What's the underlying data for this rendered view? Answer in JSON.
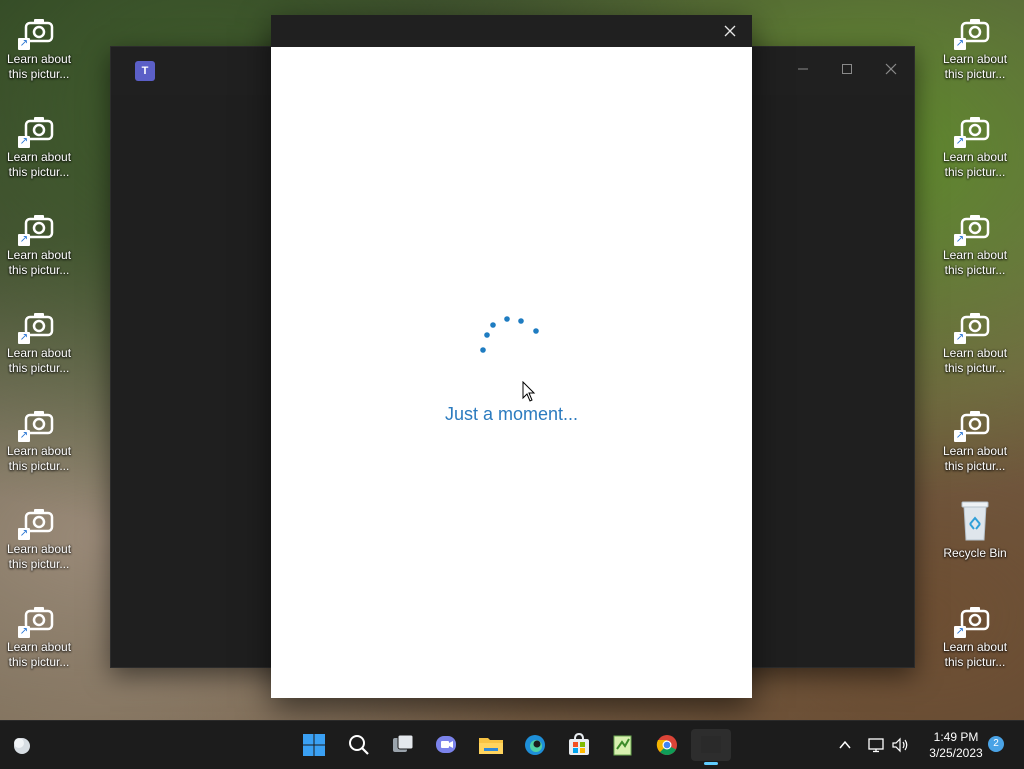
{
  "desktop": {
    "left_column": [
      {
        "label": "Learn about\nthis pictur..."
      },
      {
        "label": "Learn about\nthis pictur..."
      },
      {
        "label": "Learn about\nthis pictur..."
      },
      {
        "label": "Learn about\nthis pictur..."
      },
      {
        "label": "Learn about\nthis pictur..."
      },
      {
        "label": "Learn about\nthis pictur..."
      },
      {
        "label": "Learn about\nthis pictur..."
      }
    ],
    "right_column": [
      {
        "label": "Learn about\nthis pictur..."
      },
      {
        "label": "Learn about\nthis pictur..."
      },
      {
        "label": "Learn about\nthis pictur..."
      },
      {
        "label": "Learn about\nthis pictur..."
      },
      {
        "label": "Learn about\nthis pictur..."
      },
      {
        "label": "Recycle Bin"
      },
      {
        "label": "Learn about\nthis pictur..."
      }
    ]
  },
  "teams_window": {
    "logo_letter": "T"
  },
  "dialog": {
    "loading_text": "Just a moment..."
  },
  "taskbar": {
    "apps": [
      "widgets-icon",
      "start-icon",
      "search-icon",
      "task-view-icon",
      "teams-chat-icon",
      "file-explorer-icon",
      "edge-icon",
      "store-icon",
      "notepad-plus-icon",
      "chrome-icon",
      "active-window-icon"
    ],
    "time": "1:49 PM",
    "date": "3/25/2023",
    "notification_count": "2"
  },
  "colors": {
    "accent": "#2b7bbf",
    "taskbar": "#1c1c1c",
    "teams_purple": "#5b5fc7"
  }
}
